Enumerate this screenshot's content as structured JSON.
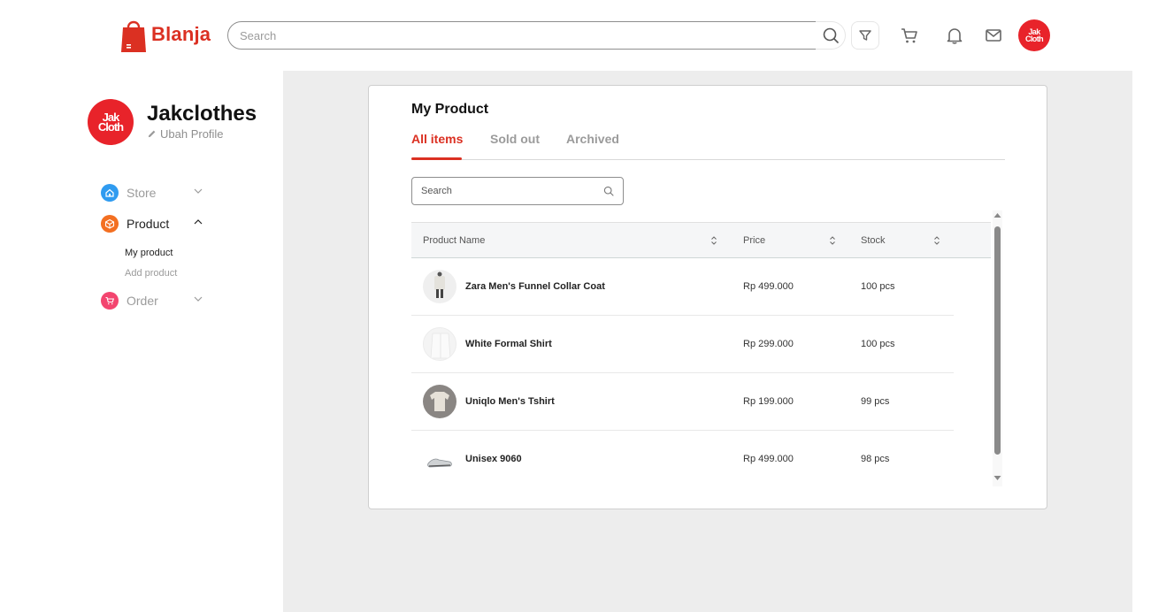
{
  "header": {
    "brand": "Blanja",
    "search_placeholder": "Search",
    "avatar_text": "Jak Cloth",
    "icons": [
      "search-icon",
      "filter-icon",
      "cart-icon",
      "bell-icon",
      "mail-icon"
    ]
  },
  "sidebar": {
    "store_name": "Jakclothes",
    "avatar_text": "Jak Cloth",
    "edit_label": "Ubah Profile",
    "nav": [
      {
        "label": "Store",
        "icon": "home-icon",
        "color": "#2f9bf0",
        "expanded": false
      },
      {
        "label": "Product",
        "icon": "box-icon",
        "color": "#f36f21",
        "expanded": true,
        "sub": [
          "My product",
          "Add product"
        ]
      },
      {
        "label": "Order",
        "icon": "cart-icon",
        "color": "#f3456f",
        "expanded": false
      }
    ]
  },
  "main": {
    "title": "My Product",
    "tabs": [
      "All items",
      "Sold out",
      "Archived"
    ],
    "active_tab": "All items",
    "search_placeholder": "Search",
    "table": {
      "columns": [
        "Product Name",
        "Price",
        "Stock"
      ],
      "rows": [
        {
          "name": "Zara Men's Funnel Collar Coat",
          "price": "Rp 499.000",
          "stock": "100 pcs"
        },
        {
          "name": "White Formal Shirt",
          "price": "Rp 299.000",
          "stock": "100 pcs"
        },
        {
          "name": "Uniqlo Men's Tshirt",
          "price": "Rp 199.000",
          "stock": "99 pcs"
        },
        {
          "name": "Unisex 9060",
          "price": "Rp 499.000",
          "stock": "98 pcs"
        }
      ]
    }
  },
  "colors": {
    "accent": "#db3022",
    "content_bg": "#ededed",
    "muted_text": "#9b9b9b"
  }
}
